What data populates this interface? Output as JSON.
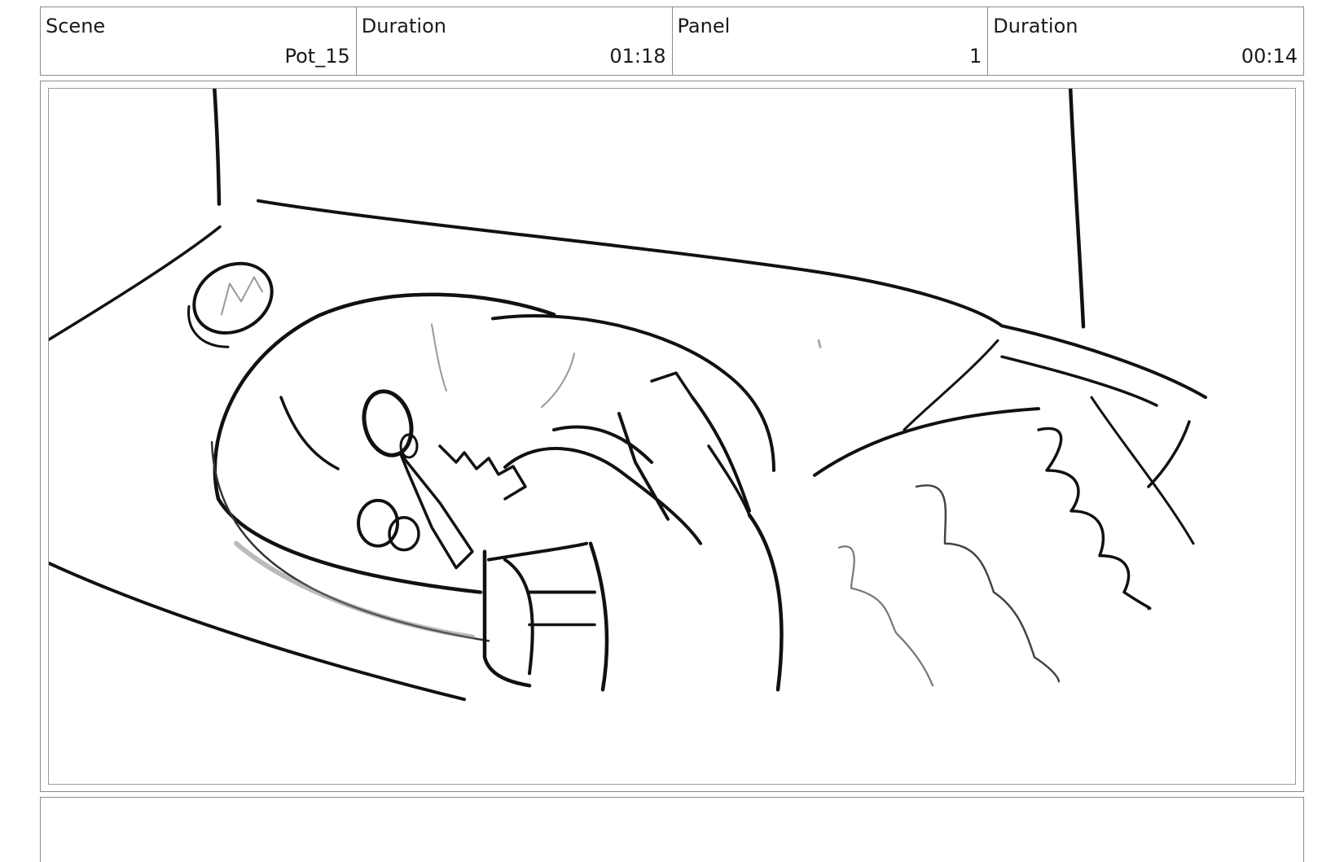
{
  "header": {
    "cells": [
      {
        "label": "Scene",
        "value": "Pot_15"
      },
      {
        "label": "Duration",
        "value": "01:18"
      },
      {
        "label": "Panel",
        "value": "1"
      },
      {
        "label": "Duration",
        "value": "00:14"
      }
    ]
  },
  "colors": {
    "border": "#8c8c8c",
    "ink": "#111111",
    "sketch_grey": "#8a8a8a"
  }
}
